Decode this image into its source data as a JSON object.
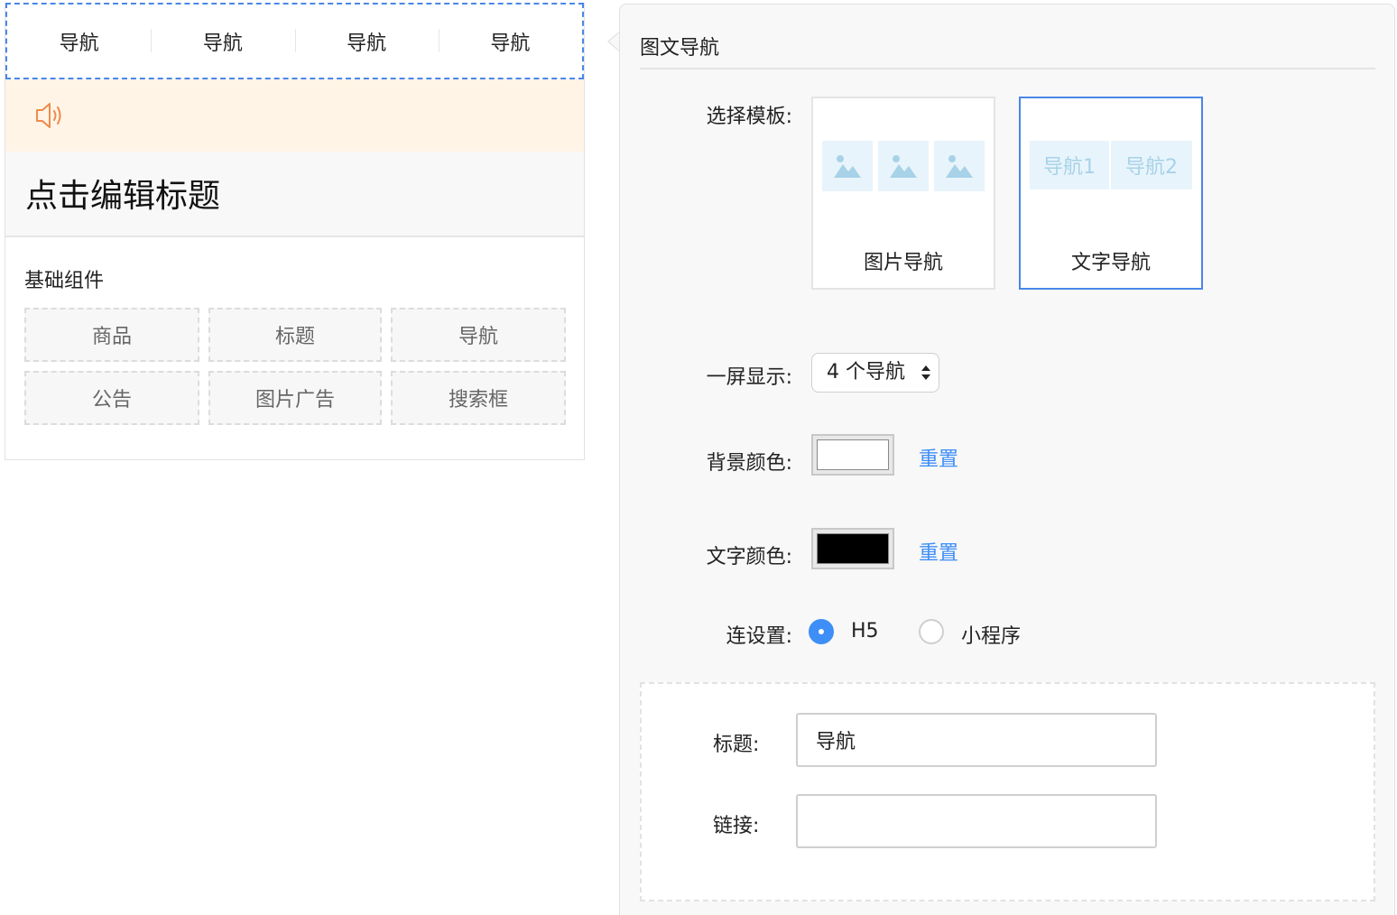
{
  "preview": {
    "nav_items": [
      "导航",
      "导航",
      "导航",
      "导航"
    ],
    "title_text": "点击编辑标题",
    "components_title": "基础组件",
    "components": [
      "商品",
      "标题",
      "导航",
      "公告",
      "图片广告",
      "搜索框"
    ]
  },
  "panel": {
    "title": "图文导航",
    "template_label": "选择模板:",
    "templates": [
      {
        "caption": "图片导航",
        "selected": false
      },
      {
        "caption": "文字导航",
        "selected": true,
        "sample_labels": [
          "导航1",
          "导航2"
        ]
      }
    ],
    "display_label": "一屏显示:",
    "display_value": "4 个导航",
    "bg_color_label": "背景颜色:",
    "bg_color": "#ffffff",
    "text_color_label": "文字颜色:",
    "text_color": "#000000",
    "reset_label": "重置",
    "link_setting_label": "连设置:",
    "link_options": [
      {
        "label": "H5",
        "checked": true
      },
      {
        "label": "小程序",
        "checked": false
      }
    ],
    "item_editor": {
      "title_label": "标题:",
      "title_value": "导航",
      "link_label": "链接:",
      "link_value": ""
    }
  },
  "colors": {
    "accent": "#3e8ef7",
    "selected_border": "#4a86e8",
    "notice_bg": "#fff4e6",
    "speaker_icon": "#f08a4b"
  }
}
